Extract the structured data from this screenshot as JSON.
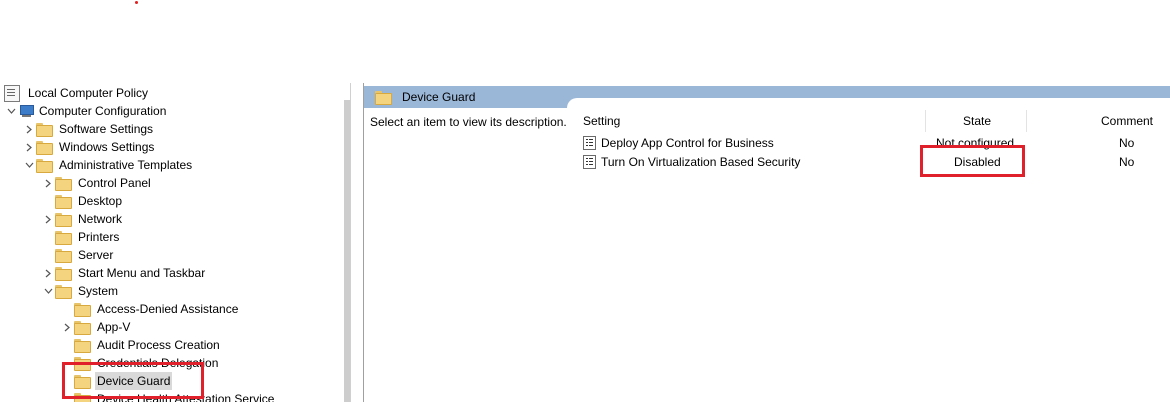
{
  "tree": {
    "root": "Local Computer Policy",
    "items": [
      {
        "label": "Computer Configuration"
      },
      {
        "label": "Software Settings"
      },
      {
        "label": "Windows Settings"
      },
      {
        "label": "Administrative Templates"
      },
      {
        "label": "Control Panel"
      },
      {
        "label": "Desktop"
      },
      {
        "label": "Network"
      },
      {
        "label": "Printers"
      },
      {
        "label": "Server"
      },
      {
        "label": "Start Menu and Taskbar"
      },
      {
        "label": "System"
      },
      {
        "label": "Access-Denied Assistance"
      },
      {
        "label": "App-V"
      },
      {
        "label": "Audit Process Creation"
      },
      {
        "label": "Credentials Delegation"
      },
      {
        "label": "Device Guard"
      },
      {
        "label": "Device Health Attestation Service"
      }
    ]
  },
  "right": {
    "header_title": "Device Guard",
    "description": "Select an item to view its description.",
    "columns": {
      "setting": "Setting",
      "state": "State",
      "comment": "Comment"
    },
    "rows": [
      {
        "setting": "Deploy App Control for Business",
        "state": "Not configured",
        "comment": "No"
      },
      {
        "setting": "Turn On Virtualization Based Security",
        "state": "Disabled",
        "comment": "No"
      }
    ]
  },
  "colors": {
    "header_bar": "#9bb7d8",
    "highlight": "#e0202a",
    "selection": "#d9d9d9"
  }
}
